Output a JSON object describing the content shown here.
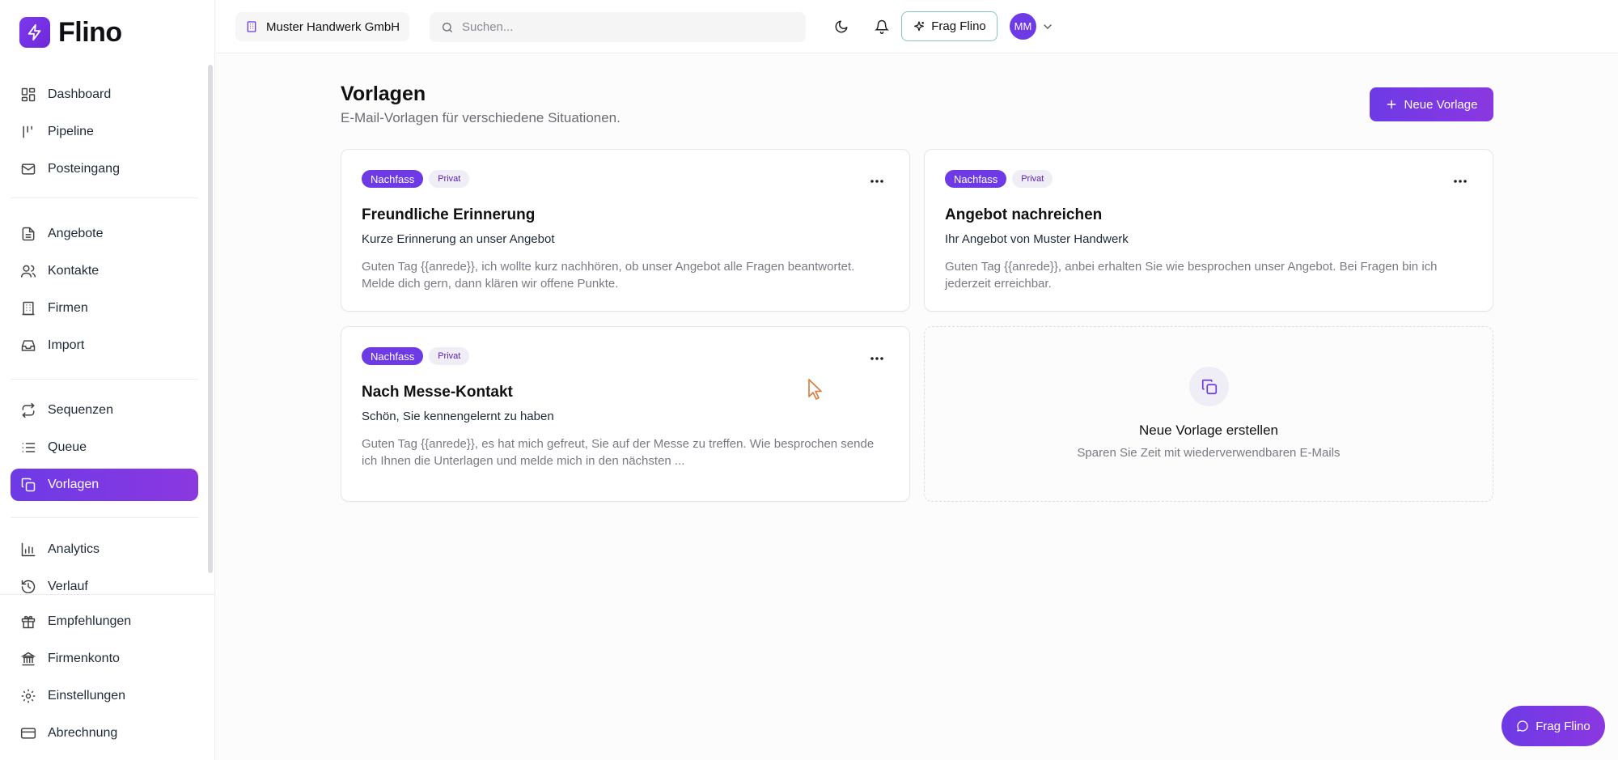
{
  "brand": {
    "name": "Flino",
    "accent": "#6d3ae6"
  },
  "sidebar": {
    "items": [
      {
        "label": "Dashboard",
        "icon": "grid-icon"
      },
      {
        "label": "Pipeline",
        "icon": "pipeline-icon"
      },
      {
        "label": "Posteingang",
        "icon": "mail-icon"
      },
      {
        "label": "Angebote",
        "icon": "document-icon"
      },
      {
        "label": "Kontakte",
        "icon": "users-icon"
      },
      {
        "label": "Firmen",
        "icon": "building-icon"
      },
      {
        "label": "Import",
        "icon": "inbox-icon"
      },
      {
        "label": "Sequenzen",
        "icon": "repeat-icon"
      },
      {
        "label": "Queue",
        "icon": "list-icon"
      },
      {
        "label": "Vorlagen",
        "icon": "copy-icon",
        "active": true
      },
      {
        "label": "Analytics",
        "icon": "bar-chart-icon"
      },
      {
        "label": "Verlauf",
        "icon": "history-icon"
      }
    ],
    "bottom": [
      {
        "label": "Empfehlungen",
        "icon": "gift-icon"
      },
      {
        "label": "Firmenkonto",
        "icon": "bank-icon"
      },
      {
        "label": "Einstellungen",
        "icon": "gear-icon"
      },
      {
        "label": "Abrechnung",
        "icon": "credit-card-icon"
      }
    ]
  },
  "topbar": {
    "company": "Muster Handwerk GmbH",
    "search_placeholder": "Suchen...",
    "ask_label": "Frag Flino",
    "avatar_initials": "MM"
  },
  "page": {
    "title": "Vorlagen",
    "subtitle": "E-Mail-Vorlagen für verschiedene Situationen.",
    "new_button": "Neue Vorlage"
  },
  "templates": [
    {
      "tag": "Nachfass",
      "visibility": "Privat",
      "title": "Freundliche Erinnerung",
      "subject": "Kurze Erinnerung an unser Angebot",
      "body": "Guten Tag {{anrede}}, ich wollte kurz nachhören, ob unser Angebot alle Fragen beantwortet. Melde dich gern, dann klären wir offene Punkte."
    },
    {
      "tag": "Nachfass",
      "visibility": "Privat",
      "title": "Angebot nachreichen",
      "subject": "Ihr Angebot von Muster Handwerk",
      "body": "Guten Tag {{anrede}}, anbei erhalten Sie wie besprochen unser Angebot. Bei Fragen bin ich jederzeit erreichbar."
    },
    {
      "tag": "Nachfass",
      "visibility": "Privat",
      "title": "Nach Messe-Kontakt",
      "subject": "Schön, Sie kennengelernt zu haben",
      "body": "Guten Tag {{anrede}}, es hat mich gefreut, Sie auf der Messe zu treffen. Wie besprochen sende ich Ihnen die Unterlagen und melde mich in den nächsten ..."
    }
  ],
  "new_card": {
    "title": "Neue Vorlage erstellen",
    "subtitle": "Sparen Sie Zeit mit wiederverwendbaren E-Mails"
  },
  "fab": {
    "label": "Frag Flino"
  }
}
